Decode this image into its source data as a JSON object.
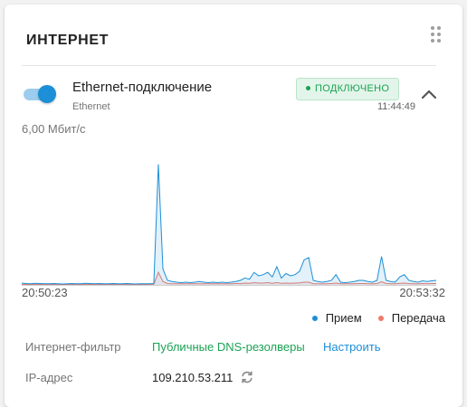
{
  "card": {
    "title": "ИНТЕРНЕТ"
  },
  "connection": {
    "enabled": true,
    "name": "Ethernet-подключение",
    "type": "Ethernet",
    "status": "ПОДКЛЮЧЕНО",
    "time": "11:44:49"
  },
  "chart_header": {
    "rate": "6,00 Мбит/с"
  },
  "colors": {
    "receive": "#1c8fd6",
    "transmit": "#f07a6a",
    "status_green": "#1aa353",
    "link_blue": "#1c8fd6"
  },
  "chart_data": {
    "type": "area",
    "x_start": "20:50:23",
    "x_end": "20:53:32",
    "y_max_label": "6,00 Мбит/с",
    "ylim": [
      0,
      6.0
    ],
    "legend": [
      "Прием",
      "Передача"
    ],
    "legend_position": "bottom-right",
    "series": [
      {
        "name": "Прием",
        "color": "#1c8fd6",
        "values": [
          0.08,
          0.06,
          0.05,
          0.07,
          0.06,
          0.05,
          0.05,
          0.06,
          0.05,
          0.04,
          0.05,
          0.06,
          0.05,
          0.05,
          0.07,
          0.06,
          0.05,
          0.06,
          0.05,
          0.05,
          0.06,
          0.05,
          0.05,
          0.06,
          0.05,
          0.04,
          0.05,
          0.05,
          0.05,
          0.06,
          5.3,
          0.7,
          0.2,
          0.15,
          0.12,
          0.1,
          0.12,
          0.1,
          0.12,
          0.15,
          0.12,
          0.1,
          0.12,
          0.1,
          0.12,
          0.1,
          0.12,
          0.15,
          0.2,
          0.3,
          0.25,
          0.55,
          0.4,
          0.45,
          0.55,
          0.35,
          0.8,
          0.3,
          0.5,
          0.4,
          0.45,
          0.6,
          1.1,
          1.2,
          0.2,
          0.15,
          0.12,
          0.15,
          0.2,
          0.45,
          0.12,
          0.1,
          0.12,
          0.15,
          0.2,
          0.2,
          0.15,
          0.12,
          0.2,
          1.25,
          0.2,
          0.15,
          0.12,
          0.35,
          0.45,
          0.2,
          0.15,
          0.12,
          0.18,
          0.15,
          0.18,
          0.2
        ]
      },
      {
        "name": "Передача",
        "color": "#f07a6a",
        "values": [
          0.02,
          0.02,
          0.02,
          0.02,
          0.02,
          0.02,
          0.02,
          0.02,
          0.02,
          0.02,
          0.02,
          0.02,
          0.02,
          0.02,
          0.02,
          0.02,
          0.02,
          0.02,
          0.02,
          0.02,
          0.02,
          0.02,
          0.02,
          0.02,
          0.02,
          0.02,
          0.02,
          0.02,
          0.02,
          0.03,
          0.55,
          0.15,
          0.06,
          0.05,
          0.05,
          0.05,
          0.05,
          0.05,
          0.05,
          0.05,
          0.05,
          0.05,
          0.05,
          0.05,
          0.05,
          0.05,
          0.05,
          0.06,
          0.06,
          0.08,
          0.07,
          0.1,
          0.08,
          0.08,
          0.1,
          0.07,
          0.1,
          0.07,
          0.08,
          0.07,
          0.08,
          0.09,
          0.12,
          0.12,
          0.05,
          0.05,
          0.05,
          0.05,
          0.06,
          0.08,
          0.05,
          0.05,
          0.05,
          0.05,
          0.06,
          0.06,
          0.05,
          0.05,
          0.06,
          0.14,
          0.06,
          0.05,
          0.05,
          0.07,
          0.08,
          0.06,
          0.05,
          0.05,
          0.06,
          0.05,
          0.06,
          0.06
        ]
      }
    ]
  },
  "info": {
    "filter_label": "Интернет-фильтр",
    "filter_value": "Публичные DNS-резолверы",
    "filter_config": "Настроить",
    "ip_label": "IP-адрес",
    "ip_value": "109.210.53.211"
  },
  "icons": {
    "drag": "drag-dots-icon",
    "collapse": "chevron-up-icon",
    "refresh": "refresh-icon"
  }
}
